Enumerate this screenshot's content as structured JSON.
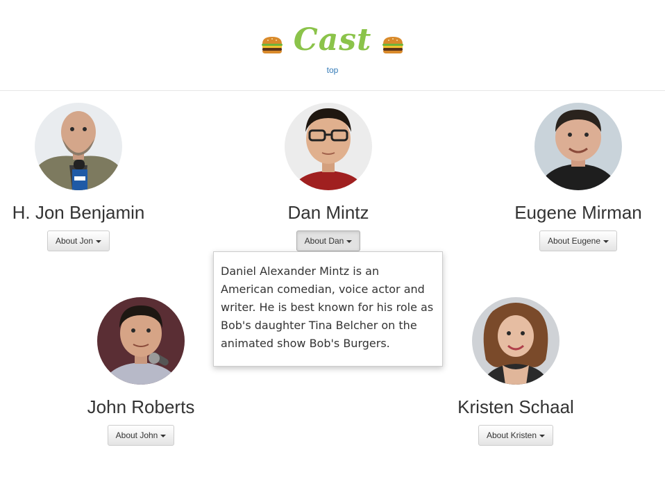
{
  "header": {
    "title": "Cast",
    "top_link": "top",
    "left_icon": "burger-icon",
    "right_icon": "burger-icon"
  },
  "cast": [
    {
      "name": "H. Jon Benjamin",
      "button": "About Jon"
    },
    {
      "name": "Dan Mintz",
      "button": "About Dan"
    },
    {
      "name": "Eugene Mirman",
      "button": "About Eugene"
    },
    {
      "name": "John Roberts",
      "button": "About John"
    },
    {
      "name": "Kristen Schaal",
      "button": "About Kristen"
    }
  ],
  "popover": {
    "text": "Daniel Alexander Mintz is an American comedian, voice actor and writer. He is best known for his role as Bob's daughter Tina Belcher on the animated show Bob's Burgers."
  },
  "colors": {
    "title": "#8bc34a",
    "link": "#337ab7",
    "text": "#333333"
  }
}
